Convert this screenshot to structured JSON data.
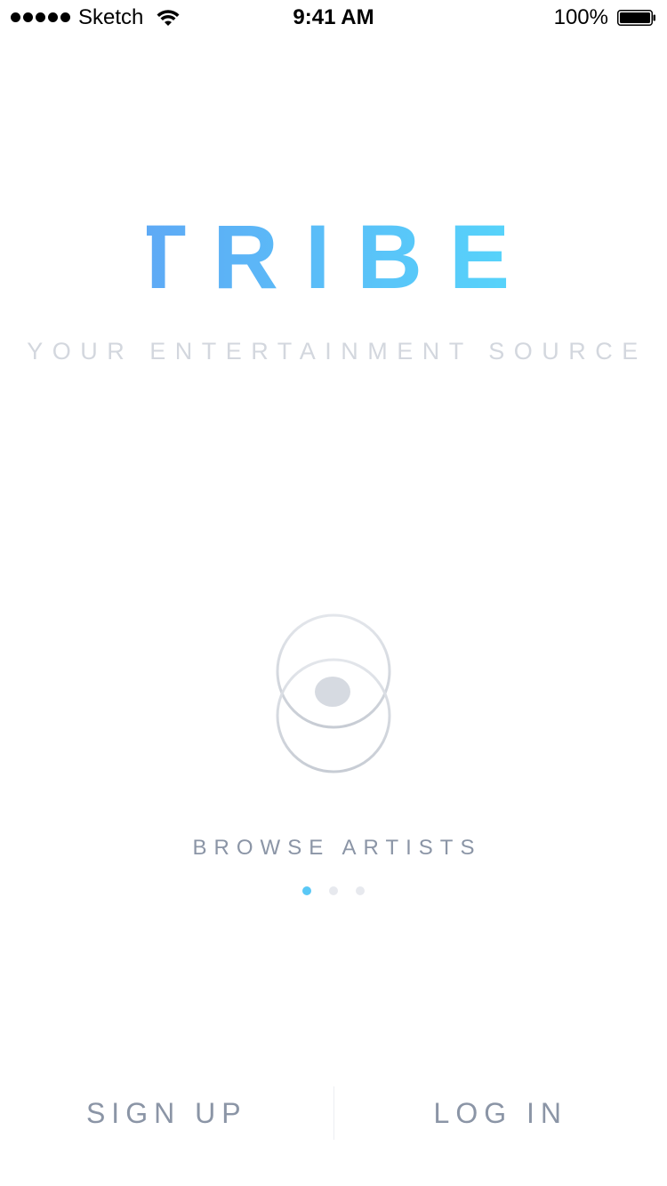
{
  "status_bar": {
    "carrier": "Sketch",
    "time": "9:41 AM",
    "battery_percent": "100%",
    "signal_icon": "signal-dots-icon",
    "wifi_icon": "wifi-icon",
    "battery_icon": "battery-icon"
  },
  "brand": {
    "logo_text": "TRIBE",
    "tagline": "YOUR ENTERTAINMENT SOURCE",
    "gradient_start": "#5ea8f5",
    "gradient_end": "#56d6fb"
  },
  "carousel": {
    "illustration_icon": "music-note-circles-icon",
    "label": "BROWSE ARTISTS",
    "page_count": 3,
    "active_page": 1,
    "active_color": "#5ac8f6",
    "inactive_color": "#e7e9ee"
  },
  "actions": {
    "sign_up_label": "SIGN UP",
    "log_in_label": "LOG IN"
  }
}
